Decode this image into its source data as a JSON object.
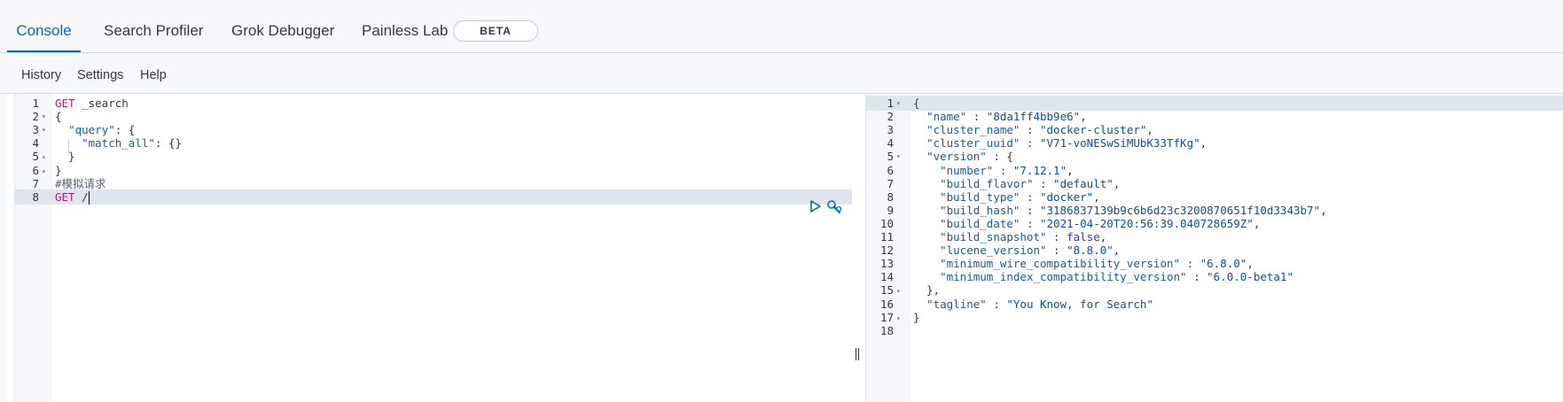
{
  "tabs": [
    {
      "label": "Console",
      "selected": true
    },
    {
      "label": "Search Profiler",
      "selected": false
    },
    {
      "label": "Grok Debugger",
      "selected": false
    },
    {
      "label": "Painless Lab",
      "selected": false,
      "badge": "BETA"
    }
  ],
  "toolbar": {
    "history": "History",
    "settings": "Settings",
    "help": "Help"
  },
  "request": {
    "lines": [
      {
        "n": "1",
        "fold": "",
        "html": "<span class=\"k-method\">GET</span> _search"
      },
      {
        "n": "2",
        "fold": "▾",
        "html": "{"
      },
      {
        "n": "3",
        "fold": "▾",
        "html": "  <span class=\"k-key\">\"query\"</span>: {"
      },
      {
        "n": "4",
        "fold": "",
        "html": "    <span class=\"k-key\">\"match_all\"</span>: {}"
      },
      {
        "n": "5",
        "fold": "▴",
        "html": "  }"
      },
      {
        "n": "6",
        "fold": "▴",
        "html": "}"
      },
      {
        "n": "7",
        "fold": "",
        "html": "<span class=\"k-comment\">#模拟请求</span>"
      },
      {
        "n": "8",
        "fold": "",
        "html": "<span class=\"k-method\">GET</span> /",
        "active": true
      }
    ]
  },
  "response": {
    "lines": [
      {
        "n": "1",
        "fold": "▾",
        "html": "{",
        "active": true
      },
      {
        "n": "2",
        "fold": "",
        "html": "  <span class=\"k-key\">\"name\"</span> : <span class=\"k-str\">\"8da1ff4bb9e6\"</span>,"
      },
      {
        "n": "3",
        "fold": "",
        "html": "  <span class=\"k-key\">\"cluster_name\"</span> : <span class=\"k-str\">\"docker-cluster\"</span>,"
      },
      {
        "n": "4",
        "fold": "",
        "html": "  <span class=\"k-key\">\"cluster_uuid\"</span> : <span class=\"k-str\">\"V71-voNESwSiMUbK33TfKg\"</span>,"
      },
      {
        "n": "5",
        "fold": "▾",
        "html": "  <span class=\"k-key\">\"version\"</span> : {"
      },
      {
        "n": "6",
        "fold": "",
        "html": "    <span class=\"k-key\">\"number\"</span> : <span class=\"k-str\">\"7.12.1\"</span>,"
      },
      {
        "n": "7",
        "fold": "",
        "html": "    <span class=\"k-key\">\"build_flavor\"</span> : <span class=\"k-str\">\"default\"</span>,"
      },
      {
        "n": "8",
        "fold": "",
        "html": "    <span class=\"k-key\">\"build_type\"</span> : <span class=\"k-str\">\"docker\"</span>,"
      },
      {
        "n": "9",
        "fold": "",
        "html": "    <span class=\"k-key\">\"build_hash\"</span> : <span class=\"k-str\">\"3186837139b9c6b6d23c3200870651f10d3343b7\"</span>,"
      },
      {
        "n": "10",
        "fold": "",
        "html": "    <span class=\"k-key\">\"build_date\"</span> : <span class=\"k-str\">\"2021-04-20T20:56:39.040728659Z\"</span>,"
      },
      {
        "n": "11",
        "fold": "",
        "html": "    <span class=\"k-key\">\"build_snapshot\"</span> : <span class=\"k-bool\">false</span>,"
      },
      {
        "n": "12",
        "fold": "",
        "html": "    <span class=\"k-key\">\"lucene_version\"</span> : <span class=\"k-str\">\"8.8.0\"</span>,"
      },
      {
        "n": "13",
        "fold": "",
        "html": "    <span class=\"k-key\">\"minimum_wire_compatibility_version\"</span> : <span class=\"k-str\">\"6.8.0\"</span>,"
      },
      {
        "n": "14",
        "fold": "",
        "html": "    <span class=\"k-key\">\"minimum_index_compatibility_version\"</span> : <span class=\"k-str\">\"6.0.0-beta1\"</span>"
      },
      {
        "n": "15",
        "fold": "▴",
        "html": "  },"
      },
      {
        "n": "16",
        "fold": "",
        "html": "  <span class=\"k-key\">\"tagline\"</span> : <span class=\"k-str\">\"You Know, for Search\"</span>"
      },
      {
        "n": "17",
        "fold": "▴",
        "html": "}"
      },
      {
        "n": "18",
        "fold": "",
        "html": ""
      }
    ]
  },
  "icons": {
    "run": "play-icon",
    "settings": "wrench-icon"
  },
  "colors": {
    "accent": "#006bb8",
    "method": "#bd137b",
    "key": "#1a5a8c",
    "string": "#0f4e8f",
    "bool": "#3b2be0"
  }
}
